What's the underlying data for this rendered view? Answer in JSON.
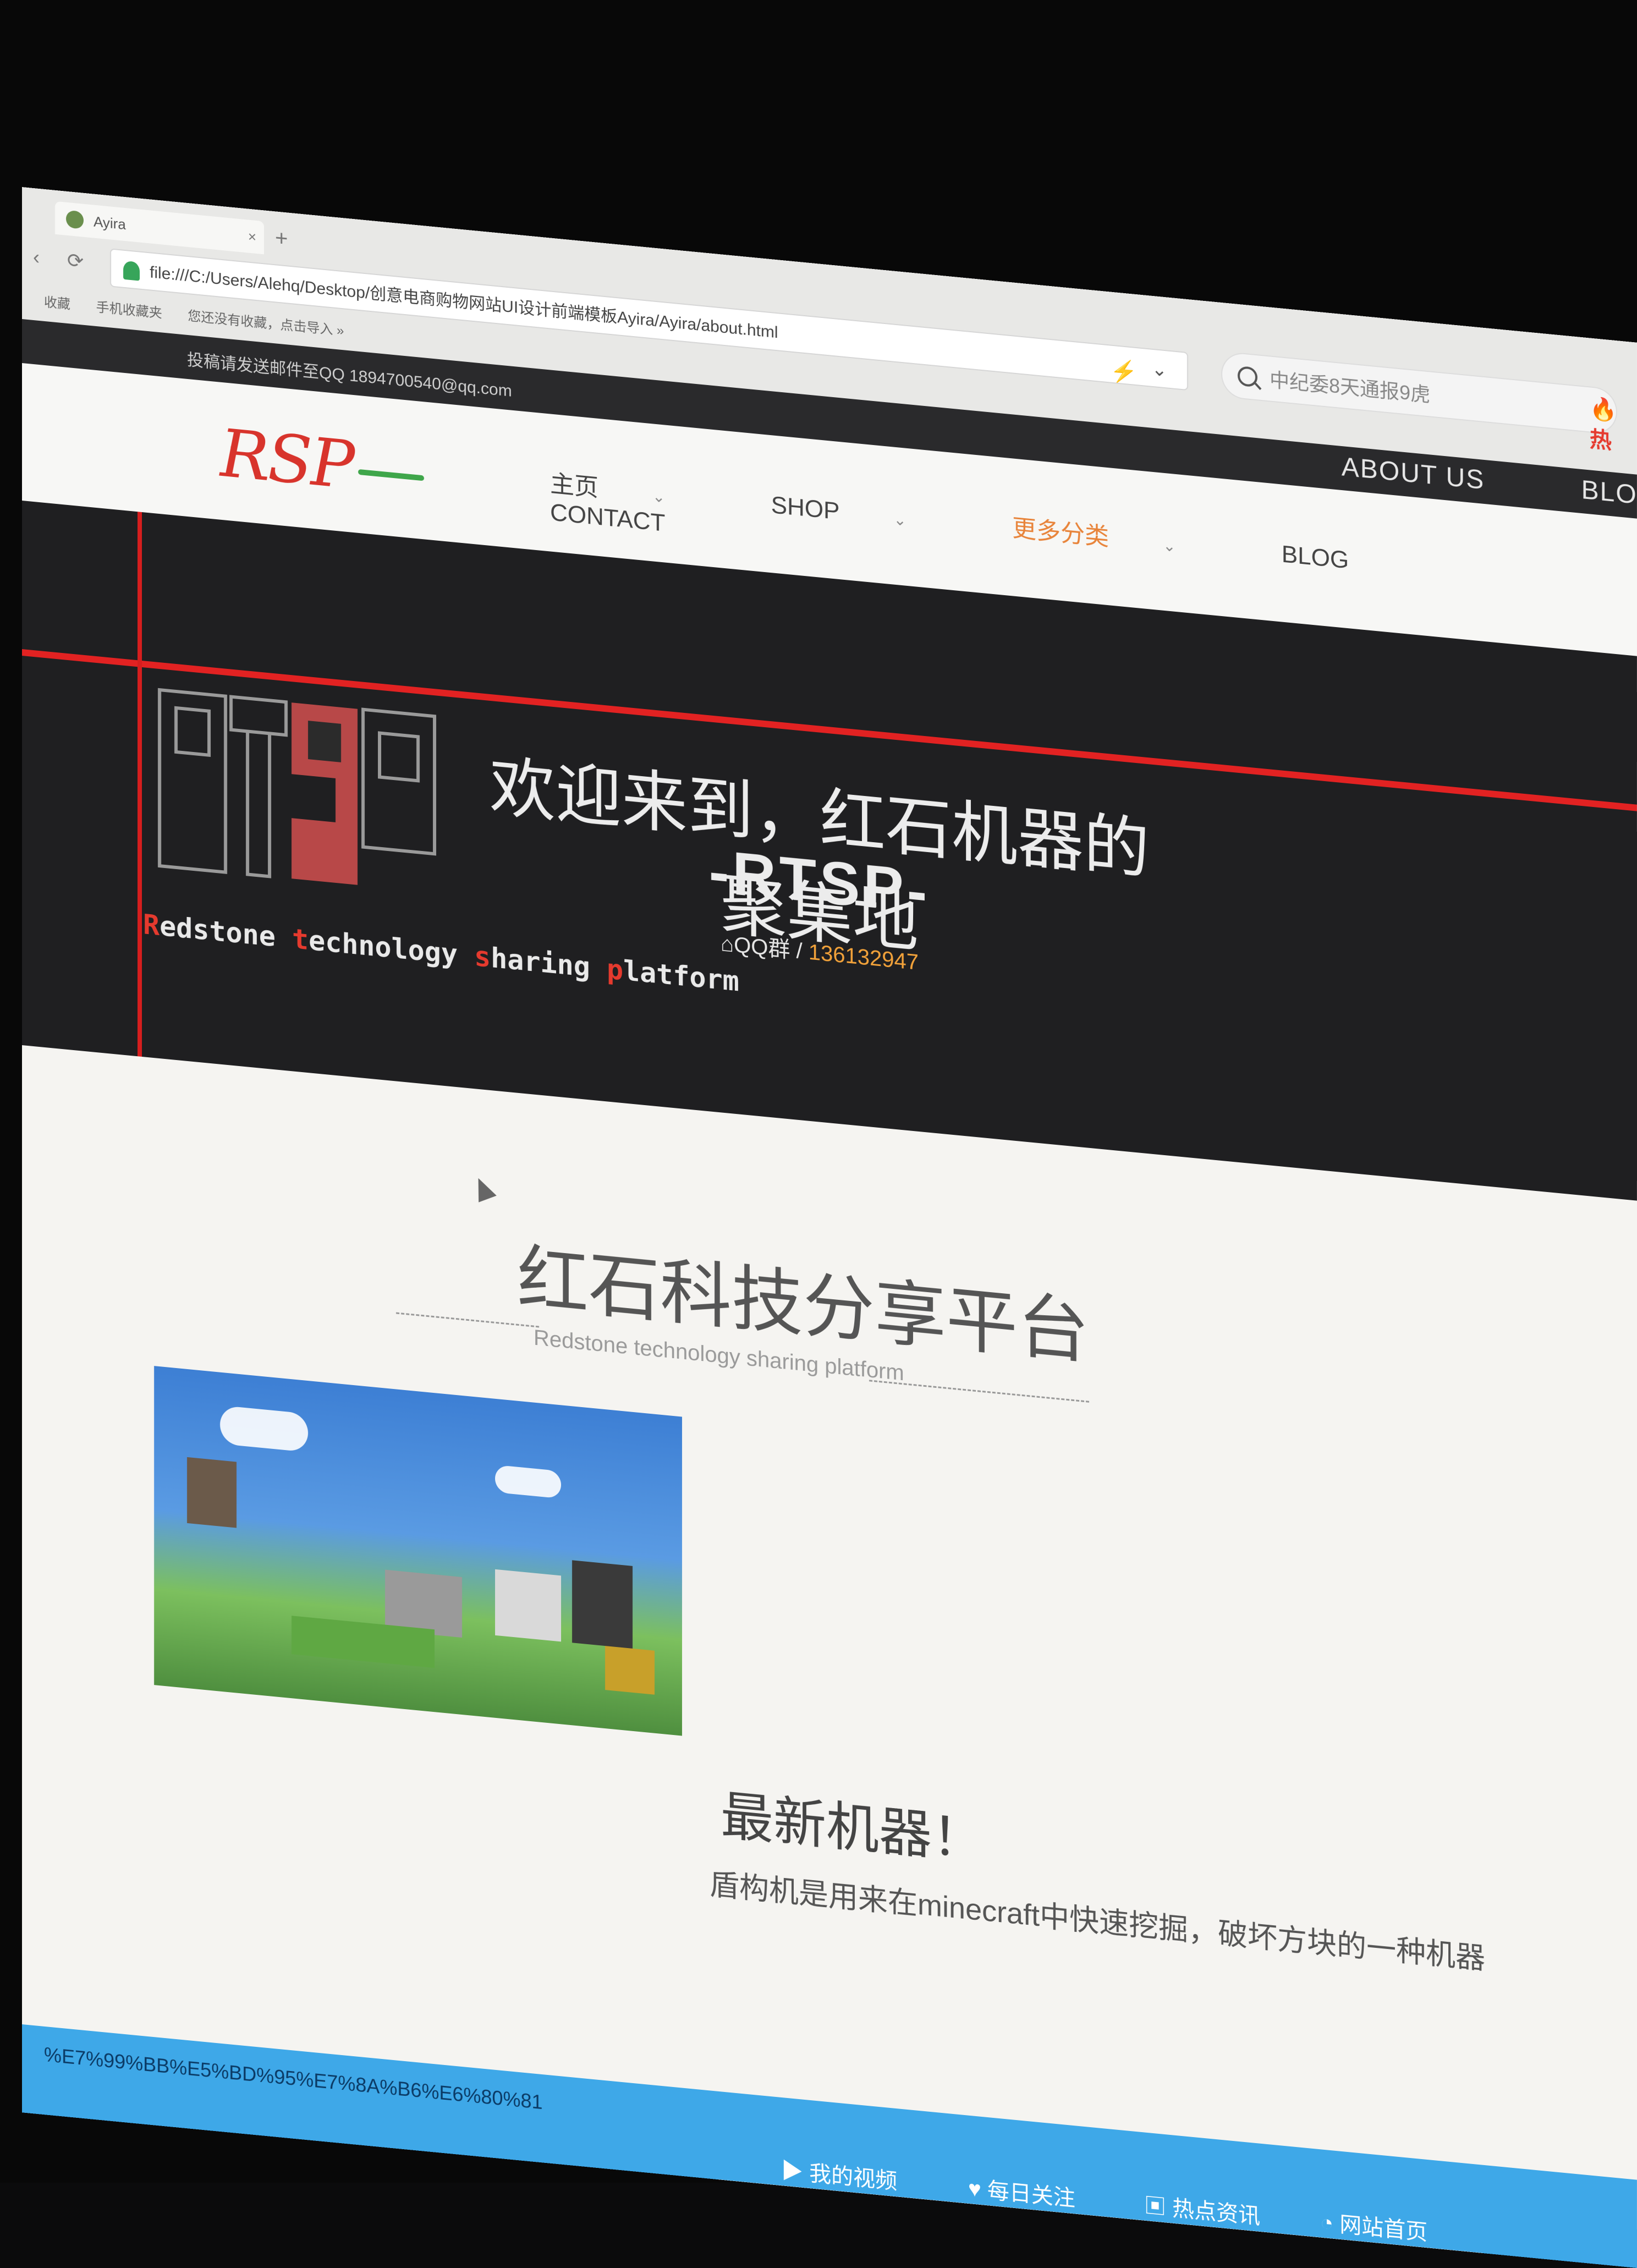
{
  "browser": {
    "tab_label": "Ayira",
    "tab_close": "×",
    "new_tab": "+",
    "nav_buttons": "‹ ⟳ ⌂",
    "address": "file:///C:/Users/Alehq/Desktop/创意电商购物网站UI设计前端模板Ayira/Ayira/about.html",
    "search_placeholder": "中纪委8天通报9虎",
    "hot_label": "热",
    "bookmarks": [
      "收藏",
      "手机收藏夹",
      "您还没有收藏，点击导入 »"
    ]
  },
  "site": {
    "topbar_notice": "投稿请发送邮件至QQ 1894700540@qq.com",
    "topbar_links": [
      "ABOUT US",
      "BLOG"
    ],
    "logo_text": "RSP",
    "menu": [
      {
        "label": "主页",
        "caret": "⌄"
      },
      {
        "label": "SHOP",
        "caret": "⌄"
      },
      {
        "label": "更多分类",
        "caret": "⌄"
      },
      {
        "label": "BLOG",
        "caret": ""
      },
      {
        "label": "CONTACT",
        "caret": ""
      }
    ],
    "banner": {
      "title": "欢迎来到，红石机器的聚集地",
      "subtitle": "-RTSP-",
      "qq_prefix": "QQ群 / ",
      "qq_number": "136132947",
      "logo_caption_parts": [
        {
          "r": "R",
          "t": "edstone "
        },
        {
          "r": "t",
          "t": "echnology "
        },
        {
          "r": "s",
          "t": "haring "
        },
        {
          "r": "p",
          "t": "latform"
        }
      ]
    },
    "section": {
      "title": "红石科技分享平台",
      "subtitle": "Redstone technology sharing platform"
    },
    "news": {
      "title": "最新机器！",
      "text": "盾构机是用来在minecraft中快速挖掘，破坏方块的一种机器"
    }
  },
  "taskbar": {
    "left_text": "%E7%99%BB%E5%BD%95%E7%8A%B6%E6%80%81",
    "items": [
      "我的视频",
      "每日关注",
      "热点资讯",
      "网站首页"
    ]
  },
  "colors": {
    "accent_orange": "#e8843a",
    "brand_red": "#e22222",
    "taskbar_blue": "#3ea8e8"
  }
}
